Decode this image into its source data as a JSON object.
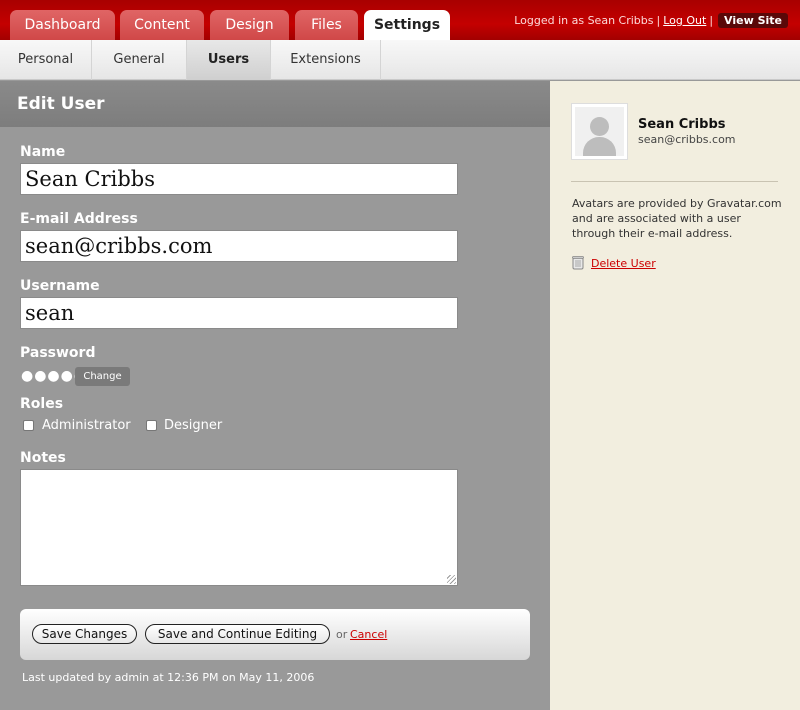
{
  "tabs": [
    "Dashboard",
    "Content",
    "Design",
    "Files",
    "Settings"
  ],
  "user_bar": {
    "logged_in_text": "Logged in as Sean Cribbs",
    "logout_label": "Log Out",
    "view_site_label": "View Site"
  },
  "subtabs": [
    "Personal",
    "General",
    "Users",
    "Extensions"
  ],
  "form": {
    "title": "Edit User",
    "name_label": "Name",
    "name_value": "Sean Cribbs",
    "email_label": "E-mail Address",
    "email_value": "sean@cribbs.com",
    "username_label": "Username",
    "username_value": "sean",
    "password_label": "Password",
    "password_mask": "●●●●●",
    "change_label": "Change",
    "roles_label": "Roles",
    "roles": [
      "Administrator",
      "Designer"
    ],
    "notes_label": "Notes",
    "notes_value": "",
    "save_label": "Save Changes",
    "save_continue_label": "Save and Continue Editing",
    "or_text": "or",
    "cancel_label": "Cancel",
    "last_updated": "Last updated by admin at 12:36 PM on May 11, 2006"
  },
  "sidebar": {
    "name": "Sean Cribbs",
    "email": "sean@cribbs.com",
    "info": "Avatars are provided by Gravatar.com and are associated with a user through their e-mail address.",
    "delete_label": "Delete User"
  }
}
